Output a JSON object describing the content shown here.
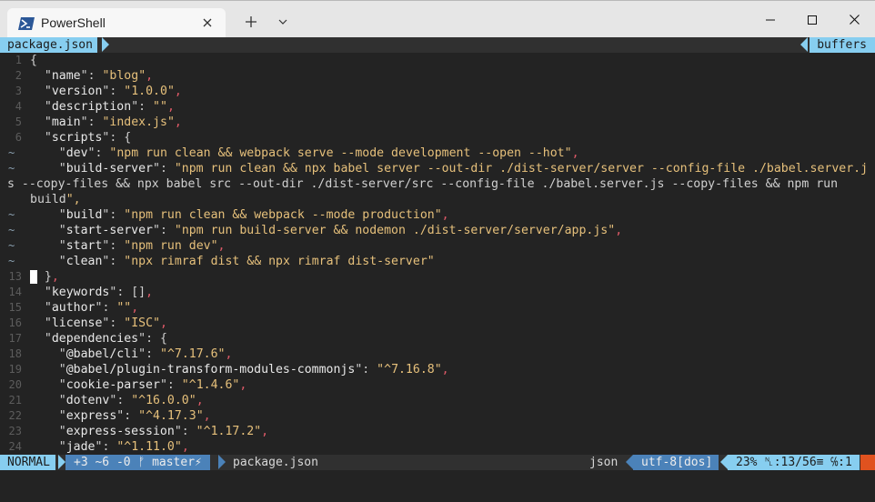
{
  "window": {
    "tab_title": "PowerShell",
    "icons": [
      "powershell-icon",
      "close-icon",
      "plus-icon",
      "chevron-down-icon",
      "minimize-icon",
      "maximize-icon",
      "close-icon"
    ]
  },
  "tabline": {
    "file": "package.json",
    "buffers_label": "buffers"
  },
  "colors": {
    "accent_light": "#87cef0",
    "accent_dark": "#4b82b9",
    "string": "#e6c07b",
    "comma": "#e05a68",
    "background": "#232323"
  },
  "editor": {
    "lines": [
      {
        "n": "1",
        "t": "{"
      },
      {
        "n": "2",
        "t": "  \"name\": \"blog\","
      },
      {
        "n": "3",
        "t": "  \"version\": \"1.0.0\","
      },
      {
        "n": "4",
        "t": "  \"description\": \"\","
      },
      {
        "n": "5",
        "t": "  \"main\": \"index.js\","
      },
      {
        "n": "6",
        "t": "  \"scripts\": {"
      },
      {
        "n": "~",
        "t": "    \"dev\": \"npm run clean && webpack serve --mode development --open --hot\","
      },
      {
        "n": "~",
        "t": "    \"build-server\": \"npm run clean && npx babel server --out-dir ./dist-server/server --config-file ./babel.server.j"
      },
      {
        "n": "",
        "t": "s --copy-files && npx babel src --out-dir ./dist-server/src --config-file ./babel.server.js --copy-files && npm run"
      },
      {
        "n": "",
        "t": "build\","
      },
      {
        "n": "~",
        "t": "    \"build\": \"npm run clean && webpack --mode production\","
      },
      {
        "n": "~",
        "t": "    \"start-server\": \"npm run build-server && nodemon ./dist-server/server/app.js\","
      },
      {
        "n": "~",
        "t": "    \"start\": \"npm run dev\","
      },
      {
        "n": "~",
        "t": "    \"clean\": \"npx rimraf dist && npx rimraf dist-server\""
      },
      {
        "n": "13",
        "t": "  },"
      },
      {
        "n": "14",
        "t": "  \"keywords\": [],"
      },
      {
        "n": "15",
        "t": "  \"author\": \"\","
      },
      {
        "n": "16",
        "t": "  \"license\": \"ISC\","
      },
      {
        "n": "17",
        "t": "  \"dependencies\": {"
      },
      {
        "n": "18",
        "t": "    \"@babel/cli\": \"^7.17.6\","
      },
      {
        "n": "19",
        "t": "    \"@babel/plugin-transform-modules-commonjs\": \"^7.16.8\","
      },
      {
        "n": "20",
        "t": "    \"cookie-parser\": \"^1.4.6\","
      },
      {
        "n": "21",
        "t": "    \"dotenv\": \"^16.0.0\","
      },
      {
        "n": "22",
        "t": "    \"express\": \"^4.17.3\","
      },
      {
        "n": "23",
        "t": "    \"express-session\": \"^1.17.2\","
      },
      {
        "n": "24",
        "t": "    \"jade\": \"^1.11.0\","
      }
    ]
  },
  "status": {
    "mode": "NORMAL",
    "git": "+3 ~6 -0 ᚠ master⚡",
    "filename": "package.json",
    "filetype": "json",
    "encoding": "utf-8[dos]",
    "position": "23% ␤:13/56≡ ℅:1"
  }
}
